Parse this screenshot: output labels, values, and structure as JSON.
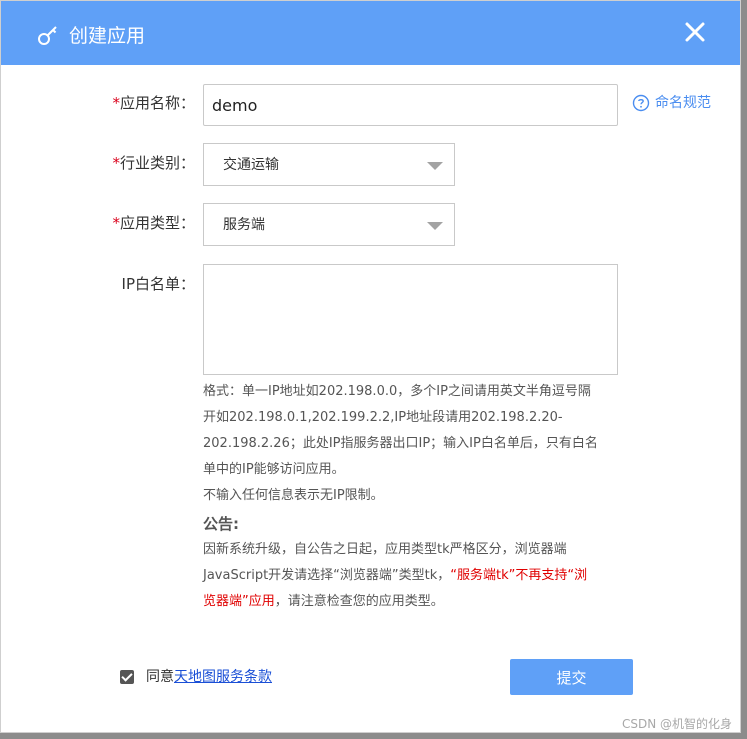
{
  "dialog": {
    "title": "创建应用",
    "icons": {
      "title": "key-icon",
      "close": "close-icon"
    }
  },
  "form": {
    "app_name": {
      "required_mark": "*",
      "label": "应用名称：",
      "value": "demo",
      "help_text": "命名规范"
    },
    "industry": {
      "required_mark": "*",
      "label": "行业类别：",
      "selected": "交通运输"
    },
    "app_type": {
      "required_mark": "*",
      "label": "应用类型：",
      "selected": "服务端"
    },
    "ip_whitelist": {
      "label": "IP白名单：",
      "value": ""
    }
  },
  "note": {
    "format": "格式：单一IP地址如202.198.0.0，多个IP之间请用英文半角逗号隔开如202.198.0.1,202.199.2.2,IP地址段请用202.198.2.20-202.198.2.26；此处IP指服务器出口IP；输入IP白名单后，只有白名单中的IP能够访问应用。",
    "no_limit": "不输入任何信息表示无IP限制。"
  },
  "notice": {
    "title": "公告:",
    "text_before": "因新系统升级，自公告之日起，应用类型tk严格区分，浏览器端JavaScript开发请选择“浏览器端”类型tk，",
    "text_red": "“服务端tk”不再支持“浏览器端”应用",
    "text_after": "，请注意检查您的应用类型。"
  },
  "agreement": {
    "checked": true,
    "prefix": "同意",
    "link_text": "天地图服务条款"
  },
  "submit_label": "提交",
  "watermark": "CSDN @机智的化身",
  "colors": {
    "header": "#5fa0f7",
    "accent": "#4a8df0",
    "warning": "#e00000"
  }
}
